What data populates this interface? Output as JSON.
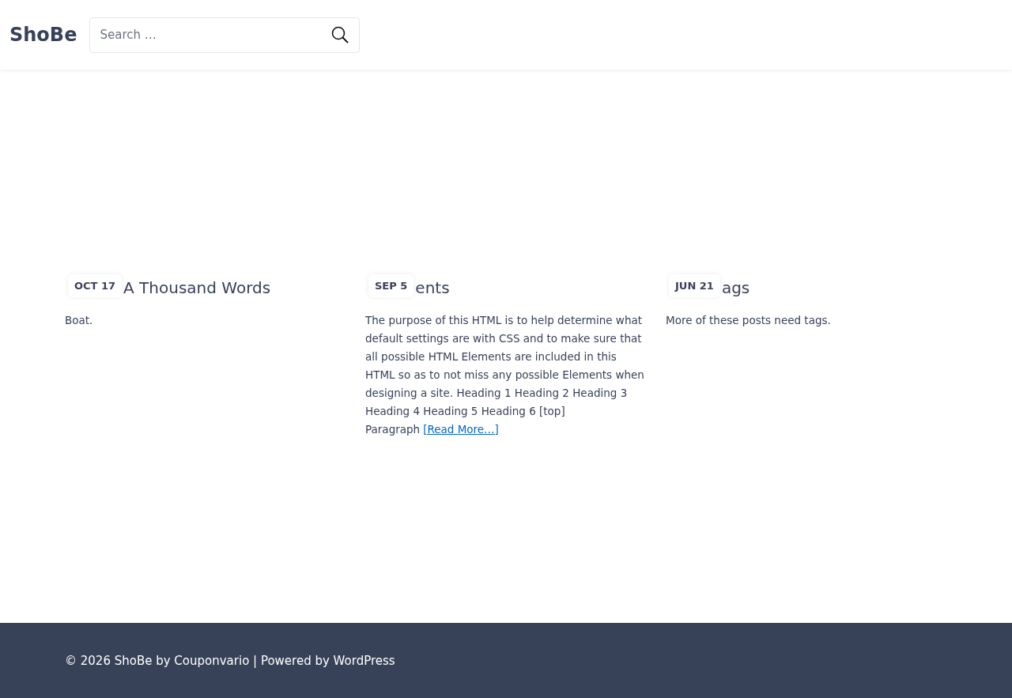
{
  "header": {
    "logo": "ShoBe",
    "search": {
      "placeholder": "Search …"
    }
  },
  "posts": [
    {
      "date": "OCT 17",
      "title": "A Thousand Words",
      "excerpt": "Boat."
    },
    {
      "date": "SEP 5",
      "title": "ents",
      "excerpt": "The purpose of this HTML is to help determine what default settings are with CSS and to make sure that all possible HTML Elements are included in this HTML so as to not miss any possible Elements when designing a site. Heading 1 Heading 2 Heading 3 Heading 4 Heading 5 Heading 6 [top] Paragraph",
      "read_more": "[Read More…]"
    },
    {
      "date": "JUN 21",
      "title": "ags",
      "excerpt": "More of these posts need tags."
    }
  ],
  "footer": {
    "text": "© 2026 ShoBe by Couponvario | Powered by WordPress"
  }
}
